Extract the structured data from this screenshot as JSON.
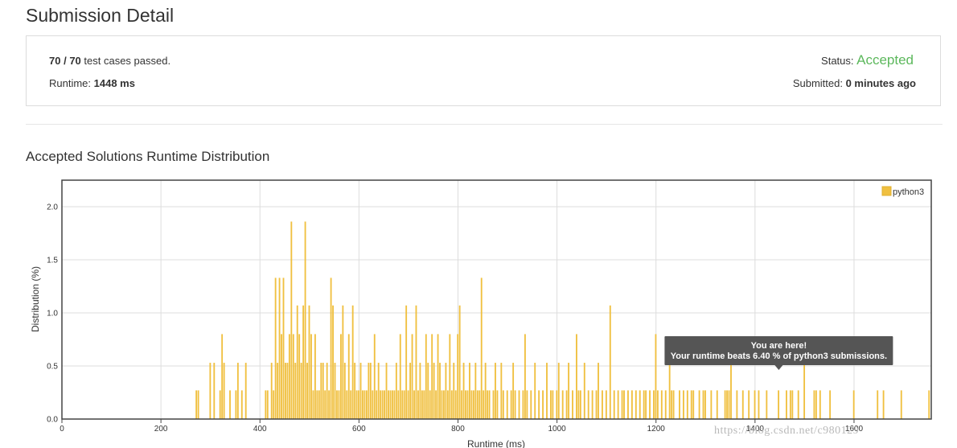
{
  "page": {
    "title": "Submission Detail",
    "section_title": "Accepted Solutions Runtime Distribution",
    "watermark": "https://blog.csdn.net/c980129"
  },
  "detail": {
    "passed_count": "70",
    "slash": " / ",
    "total_count": "70",
    "passed_suffix": " test cases passed.",
    "runtime_label": "Runtime: ",
    "runtime_value": "1448 ms",
    "status_label": "Status: ",
    "status_value": "Accepted",
    "submitted_label": "Submitted: ",
    "submitted_value": "0 minutes ago"
  },
  "colors": {
    "bar": "#f0c040",
    "bar_stroke": "#e0b030",
    "status_accepted": "#5cb85c",
    "tooltip_bg": "#555555"
  },
  "chart_data": {
    "type": "bar",
    "xlabel": "Runtime (ms)",
    "ylabel": "Distribution (%)",
    "xlim": [
      0,
      1756
    ],
    "ylim": [
      0,
      2.25
    ],
    "xticks": [
      0,
      200,
      400,
      600,
      800,
      1000,
      1200,
      1400,
      1600
    ],
    "yticks": [
      0.0,
      0.5,
      1.0,
      1.5,
      2.0
    ],
    "ytick_labels": [
      "0.0",
      "0.5",
      "1.0",
      "1.5",
      "2.0"
    ],
    "grid": true,
    "legend": [
      "python3"
    ],
    "legend_position": "top-right",
    "bin_width": 4,
    "tooltip": {
      "line1": "You are here!",
      "line2": "Your runtime beats 6.40 % of python3 submissions.",
      "x": 1448
    },
    "series": [
      {
        "name": "python3",
        "points": [
          [
            272,
            0.27
          ],
          [
            276,
            0.27
          ],
          [
            300,
            0.53
          ],
          [
            308,
            0.53
          ],
          [
            320,
            0.27
          ],
          [
            324,
            0.8
          ],
          [
            328,
            0.53
          ],
          [
            340,
            0.27
          ],
          [
            352,
            0.27
          ],
          [
            356,
            0.53
          ],
          [
            364,
            0.27
          ],
          [
            372,
            0.53
          ],
          [
            412,
            0.27
          ],
          [
            416,
            0.27
          ],
          [
            424,
            0.53
          ],
          [
            428,
            0.27
          ],
          [
            432,
            1.33
          ],
          [
            436,
            0.53
          ],
          [
            440,
            1.33
          ],
          [
            444,
            0.8
          ],
          [
            448,
            1.33
          ],
          [
            452,
            0.53
          ],
          [
            456,
            0.53
          ],
          [
            460,
            0.8
          ],
          [
            464,
            1.86
          ],
          [
            468,
            0.8
          ],
          [
            472,
            0.53
          ],
          [
            476,
            1.07
          ],
          [
            480,
            0.8
          ],
          [
            484,
            0.53
          ],
          [
            488,
            1.07
          ],
          [
            492,
            1.86
          ],
          [
            496,
            0.53
          ],
          [
            500,
            1.07
          ],
          [
            504,
            0.8
          ],
          [
            508,
            0.27
          ],
          [
            512,
            0.8
          ],
          [
            516,
            0.27
          ],
          [
            520,
            0.27
          ],
          [
            524,
            0.53
          ],
          [
            528,
            0.53
          ],
          [
            532,
            0.27
          ],
          [
            536,
            0.53
          ],
          [
            540,
            0.27
          ],
          [
            544,
            1.33
          ],
          [
            548,
            1.07
          ],
          [
            552,
            0.53
          ],
          [
            556,
            0.27
          ],
          [
            560,
            0.27
          ],
          [
            564,
            0.8
          ],
          [
            568,
            1.07
          ],
          [
            572,
            0.53
          ],
          [
            576,
            0.27
          ],
          [
            580,
            0.8
          ],
          [
            584,
            0.27
          ],
          [
            588,
            1.07
          ],
          [
            592,
            0.53
          ],
          [
            596,
            0.27
          ],
          [
            600,
            0.27
          ],
          [
            604,
            0.53
          ],
          [
            608,
            0.27
          ],
          [
            612,
            0.27
          ],
          [
            616,
            0.27
          ],
          [
            620,
            0.53
          ],
          [
            624,
            0.53
          ],
          [
            628,
            0.27
          ],
          [
            632,
            0.8
          ],
          [
            636,
            0.27
          ],
          [
            640,
            0.53
          ],
          [
            644,
            0.27
          ],
          [
            648,
            0.27
          ],
          [
            652,
            0.27
          ],
          [
            656,
            0.53
          ],
          [
            660,
            0.27
          ],
          [
            664,
            0.27
          ],
          [
            668,
            0.27
          ],
          [
            672,
            0.27
          ],
          [
            676,
            0.53
          ],
          [
            680,
            0.27
          ],
          [
            684,
            0.8
          ],
          [
            688,
            0.27
          ],
          [
            692,
            0.27
          ],
          [
            696,
            1.07
          ],
          [
            700,
            0.27
          ],
          [
            704,
            0.53
          ],
          [
            708,
            0.8
          ],
          [
            712,
            0.27
          ],
          [
            716,
            1.07
          ],
          [
            720,
            0.27
          ],
          [
            724,
            0.53
          ],
          [
            728,
            0.27
          ],
          [
            732,
            0.27
          ],
          [
            736,
            0.8
          ],
          [
            740,
            0.53
          ],
          [
            744,
            0.27
          ],
          [
            748,
            0.8
          ],
          [
            752,
            0.53
          ],
          [
            756,
            0.27
          ],
          [
            760,
            0.8
          ],
          [
            764,
            0.53
          ],
          [
            768,
            0.27
          ],
          [
            772,
            0.27
          ],
          [
            776,
            0.53
          ],
          [
            780,
            0.27
          ],
          [
            784,
            0.8
          ],
          [
            788,
            0.27
          ],
          [
            792,
            0.53
          ],
          [
            796,
            0.27
          ],
          [
            800,
            0.8
          ],
          [
            804,
            1.07
          ],
          [
            808,
            0.27
          ],
          [
            812,
            0.53
          ],
          [
            816,
            0.27
          ],
          [
            820,
            0.27
          ],
          [
            824,
            0.53
          ],
          [
            828,
            0.27
          ],
          [
            832,
            0.27
          ],
          [
            836,
            0.53
          ],
          [
            840,
            0.27
          ],
          [
            844,
            0.27
          ],
          [
            848,
            1.33
          ],
          [
            852,
            0.27
          ],
          [
            856,
            0.53
          ],
          [
            860,
            0.27
          ],
          [
            864,
            0.27
          ],
          [
            872,
            0.27
          ],
          [
            876,
            0.53
          ],
          [
            880,
            0.27
          ],
          [
            888,
            0.53
          ],
          [
            892,
            0.27
          ],
          [
            900,
            0.27
          ],
          [
            908,
            0.27
          ],
          [
            912,
            0.53
          ],
          [
            916,
            0.27
          ],
          [
            924,
            0.27
          ],
          [
            932,
            0.27
          ],
          [
            936,
            0.8
          ],
          [
            940,
            0.27
          ],
          [
            948,
            0.27
          ],
          [
            956,
            0.53
          ],
          [
            964,
            0.27
          ],
          [
            972,
            0.27
          ],
          [
            980,
            0.53
          ],
          [
            988,
            0.27
          ],
          [
            992,
            0.27
          ],
          [
            1000,
            0.27
          ],
          [
            1004,
            0.53
          ],
          [
            1012,
            0.27
          ],
          [
            1020,
            0.27
          ],
          [
            1024,
            0.53
          ],
          [
            1032,
            0.27
          ],
          [
            1040,
            0.8
          ],
          [
            1044,
            0.27
          ],
          [
            1048,
            0.27
          ],
          [
            1056,
            0.53
          ],
          [
            1064,
            0.27
          ],
          [
            1072,
            0.27
          ],
          [
            1080,
            0.27
          ],
          [
            1084,
            0.53
          ],
          [
            1092,
            0.27
          ],
          [
            1100,
            0.27
          ],
          [
            1108,
            1.07
          ],
          [
            1116,
            0.27
          ],
          [
            1124,
            0.27
          ],
          [
            1132,
            0.27
          ],
          [
            1136,
            0.27
          ],
          [
            1144,
            0.27
          ],
          [
            1152,
            0.27
          ],
          [
            1160,
            0.27
          ],
          [
            1168,
            0.27
          ],
          [
            1176,
            0.27
          ],
          [
            1180,
            0.27
          ],
          [
            1188,
            0.27
          ],
          [
            1196,
            0.27
          ],
          [
            1200,
            0.8
          ],
          [
            1204,
            0.27
          ],
          [
            1212,
            0.27
          ],
          [
            1220,
            0.27
          ],
          [
            1228,
            0.53
          ],
          [
            1232,
            0.27
          ],
          [
            1236,
            0.27
          ],
          [
            1248,
            0.27
          ],
          [
            1256,
            0.27
          ],
          [
            1264,
            0.27
          ],
          [
            1272,
            0.27
          ],
          [
            1276,
            0.27
          ],
          [
            1288,
            0.27
          ],
          [
            1296,
            0.27
          ],
          [
            1300,
            0.27
          ],
          [
            1312,
            0.27
          ],
          [
            1324,
            0.27
          ],
          [
            1340,
            0.27
          ],
          [
            1344,
            0.27
          ],
          [
            1348,
            0.27
          ],
          [
            1352,
            0.53
          ],
          [
            1364,
            0.27
          ],
          [
            1376,
            0.27
          ],
          [
            1388,
            0.27
          ],
          [
            1400,
            0.27
          ],
          [
            1408,
            0.27
          ],
          [
            1424,
            0.27
          ],
          [
            1448,
            0.27
          ],
          [
            1464,
            0.27
          ],
          [
            1472,
            0.27
          ],
          [
            1476,
            0.27
          ],
          [
            1488,
            0.27
          ],
          [
            1500,
            0.53
          ],
          [
            1520,
            0.27
          ],
          [
            1524,
            0.27
          ],
          [
            1532,
            0.27
          ],
          [
            1552,
            0.27
          ],
          [
            1600,
            0.27
          ],
          [
            1648,
            0.27
          ],
          [
            1660,
            0.27
          ],
          [
            1696,
            0.27
          ],
          [
            1752,
            0.27
          ]
        ]
      }
    ]
  }
}
